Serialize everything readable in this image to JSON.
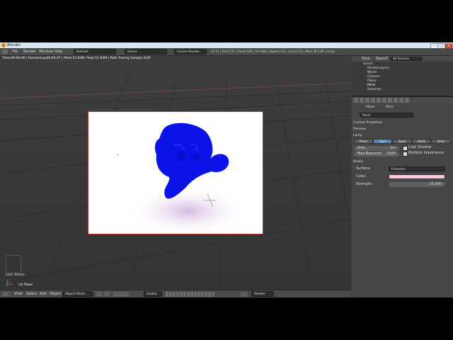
{
  "window": {
    "title": "Blender",
    "min": "–",
    "max": "□",
    "close": "×"
  },
  "info_header": {
    "menus": [
      "File",
      "Render",
      "Window",
      "Help"
    ],
    "screen_layout": "Default",
    "scene": "Scene",
    "render_engine": "Cycles Render",
    "stats": "v2.72 | Verts:511 | Faces:500 | Tris:968 | Objects:1/4 | Lamps:1/2 | Mem:38.13M | Lamp"
  },
  "viewport": {
    "status": "Time:00:00.96 | Remaining:00:00.67 | Mem:11.64M, Peak:11.64M | Path Tracing Sample 2/20",
    "last_op_label": "Last: Resize",
    "object_name": "(3) Plane"
  },
  "viewport_header": {
    "menus": [
      "View",
      "Select",
      "Add",
      "Object"
    ],
    "mode": "Object Mode",
    "pivot": "Global",
    "layer_name": "Render Layer"
  },
  "outliner": {
    "header": {
      "view": "View",
      "search": "Search",
      "filter": "All Scenes"
    },
    "items": [
      "Scene",
      "RenderLayers",
      "World",
      "Camera",
      "Plane",
      "Point",
      "Suzanne"
    ]
  },
  "properties": {
    "breadcrumb": [
      "Plane",
      "Point"
    ],
    "datablock_name": "Point",
    "panels": {
      "custom_props": "Custom Properties",
      "preview": "Preview",
      "lamp": "Lamp",
      "nodes": "Nodes"
    },
    "lamp_types": [
      "Point",
      "Sun",
      "Spot",
      "Hemi",
      "Area"
    ],
    "active_lamp_type": "Sun",
    "size_label": "Size:",
    "size_value": "1m",
    "max_bounces_label": "Max Bounces:",
    "max_bounces_value": "1024",
    "cast_shadow": "Cast Shadow",
    "multiple_importance": "Multiple Importance",
    "surface_label": "Surface:",
    "surface_value": "Emission",
    "color_label": "Color:",
    "strength_label": "Strength:",
    "strength_value": "10.000"
  },
  "colors": {
    "accent": "#5680c2",
    "emission": "#f5c6e0",
    "monkey": "#0a14e6",
    "render_border": "#b43a3a"
  }
}
